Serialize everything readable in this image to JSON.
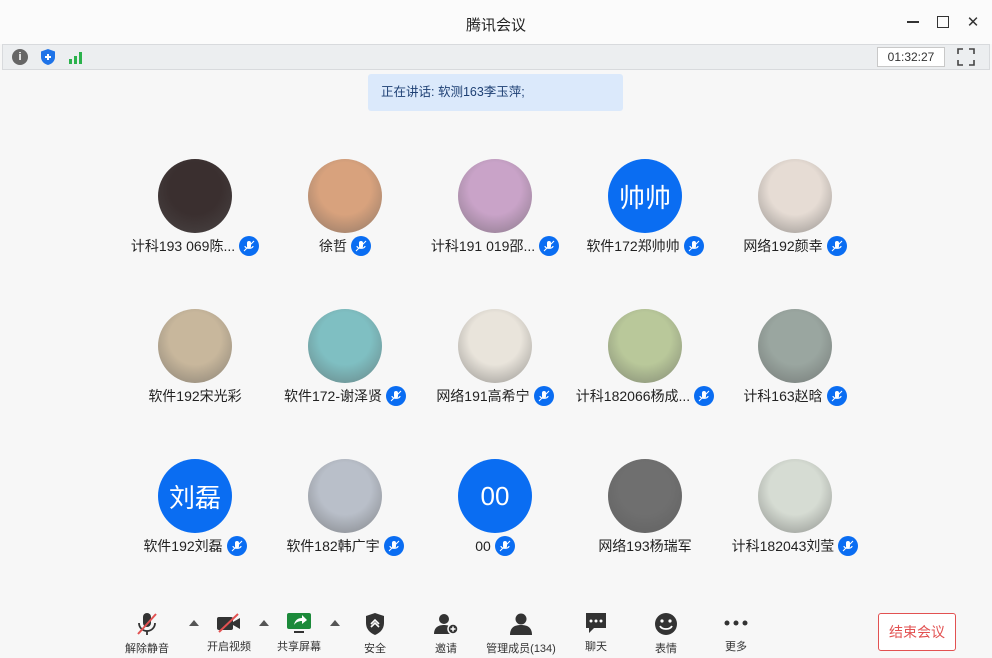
{
  "window": {
    "title": "腾讯会议"
  },
  "statusbar": {
    "timer": "01:32:27",
    "icons": [
      "info-icon",
      "shield-icon",
      "signal-icon",
      "fullscreen-icon"
    ]
  },
  "speaking": {
    "text": "正在讲话: 软测163李玉萍;"
  },
  "participants": [
    {
      "name": "计科193 069陈...",
      "mic": true,
      "avatar": "photo-dark-person",
      "bg": "#3a2f2f"
    },
    {
      "name": "徐哲",
      "mic": true,
      "avatar": "photo-cat",
      "bg": "#d8a27d"
    },
    {
      "name": "计科191 019邵...",
      "mic": true,
      "avatar": "photo-anime",
      "bg": "#c9a3c8"
    },
    {
      "name": "软件172郑帅帅",
      "mic": true,
      "avatar_text": "帅帅",
      "bg": "#0a6df2"
    },
    {
      "name": "网络192颜幸",
      "mic": true,
      "avatar": "photo-girl",
      "bg": "#e6dcd4"
    },
    {
      "name": "软件192宋光彩",
      "mic": false,
      "avatar": "photo-bear",
      "bg": "#c8b79c"
    },
    {
      "name": "软件172-谢泽贤",
      "mic": true,
      "avatar": "photo-bird",
      "bg": "#7fbfc2"
    },
    {
      "name": "网络191高希宁",
      "mic": true,
      "avatar": "photo-girl-yellow",
      "bg": "#e9e4db"
    },
    {
      "name": "计科182066杨成...",
      "mic": true,
      "avatar": "photo-dog",
      "bg": "#b9c89a"
    },
    {
      "name": "计科163赵晗",
      "mic": true,
      "avatar": "photo-girl-park",
      "bg": "#9aa6a0"
    },
    {
      "name": "软件192刘磊",
      "mic": true,
      "avatar_text": "刘磊",
      "bg": "#0a6df2"
    },
    {
      "name": "软件182韩广宇",
      "mic": true,
      "avatar": "photo-anime-boy",
      "bg": "#b9bfc9"
    },
    {
      "name": "00",
      "mic": true,
      "avatar_text": "00",
      "bg": "#0a6df2"
    },
    {
      "name": "网络193杨瑞军",
      "mic": false,
      "avatar": "photo-man",
      "bg": "#6f6f6f"
    },
    {
      "name": "计科182043刘莹",
      "mic": true,
      "avatar": "photo-couple",
      "bg": "#d6dcd3"
    }
  ],
  "toolbar": {
    "unmute": "解除静音",
    "video": "开启视频",
    "share": "共享屏幕",
    "security": "安全",
    "invite": "邀请",
    "members": "管理成员(134)",
    "chat": "聊天",
    "emoji": "表情",
    "more": "更多",
    "end": "结束会议"
  },
  "colors": {
    "accent": "#0a6df2",
    "end": "#e25151",
    "banner": "#dbe9fb"
  }
}
